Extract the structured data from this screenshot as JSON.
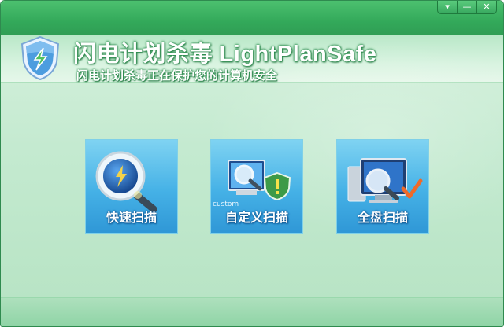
{
  "window": {
    "title": "闪电计划杀毒 LightPlanSafe",
    "subtitle": "闪电计划杀毒正在保护您的计算机安全",
    "controls": {
      "menu": "▾",
      "minimize": "—",
      "close": "✕"
    }
  },
  "tiles": [
    {
      "label": "快速扫描",
      "icon": "quick-scan-magnifier-icon"
    },
    {
      "label": "自定义扫描",
      "sublabel": "custom",
      "icon": "custom-scan-icon"
    },
    {
      "label": "全盘扫描",
      "icon": "full-scan-computer-icon"
    }
  ],
  "colors": {
    "brand_green": "#33a95a",
    "tile_blue": "#45b1e6",
    "background": "#c4ead0"
  }
}
